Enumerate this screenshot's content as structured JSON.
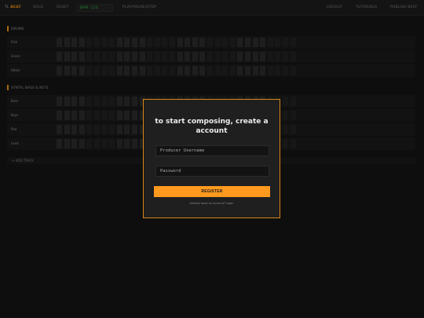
{
  "topbar": {
    "logo_left": "TL",
    "logo_right": "BEAT",
    "items": [
      "SOLO",
      "RESET"
    ],
    "bpm_value": "BPM: 120",
    "pattern": "PLAY/PAUSE/STOP",
    "right_items": [
      "LOGOUT",
      "TUTORIALS",
      "PUBLISH BEAT"
    ]
  },
  "workspace": {
    "drums_label": "DRUMS",
    "drum_tracks": [
      "Kick",
      "Snare",
      "HiHat"
    ],
    "synth_label": "SYNTH, BASS & KEYS",
    "synth_tracks": [
      "Bass",
      "Keys",
      "Pad",
      "Lead"
    ],
    "add_track_label": "+ ADD TRACK"
  },
  "modal": {
    "title": "to start composing, create a account",
    "username_placeholder": "Producer Username",
    "password_placeholder": "Password",
    "register_label": "REGISTER",
    "login_prompt": "Already have an account? Login"
  },
  "colors": {
    "accent": "#ff9a1f",
    "bpm_green": "#35c24a",
    "background": "#161616"
  }
}
